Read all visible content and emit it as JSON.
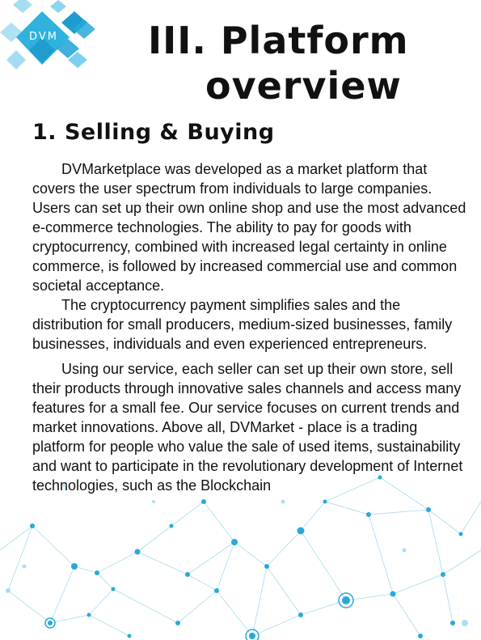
{
  "logo": {
    "text": "DVM"
  },
  "title": {
    "line1": "III. Platform",
    "line2": "overview"
  },
  "section": {
    "heading": "1. Selling & Buying",
    "paragraphs": [
      "DVMarketplace was developed as a market platform that covers the user spectrum from individuals to large companies. Users can set up their own online shop and use the most advanced e-commerce technologies. The ability to pay for goods with cryptocurrency, combined with increased legal certainty in online commerce, is followed by increased commercial use and common societal acceptance.",
      "The cryptocurrency payment simplifies sales and the distribution for small producers, medium-sized businesses, family businesses, individuals and even experienced entrepreneurs.",
      "Using our service, each seller can set up their own store, sell their products through innovative sales channels and access many features for a small fee. Our service focuses on current trends and market innovations. Above all, DVMarket - place is a trading platform for people who value the sale of used items, sustainability and want to participate in the revolutionary development of Internet technologies, such as the Blockchain"
    ]
  },
  "colors": {
    "accent": "#29a9d8",
    "accent_light": "#8fd4ee",
    "text": "#111111"
  },
  "decor": {
    "logo_shape": "diamond-logo-icon",
    "background": "network-graph-decoration"
  }
}
